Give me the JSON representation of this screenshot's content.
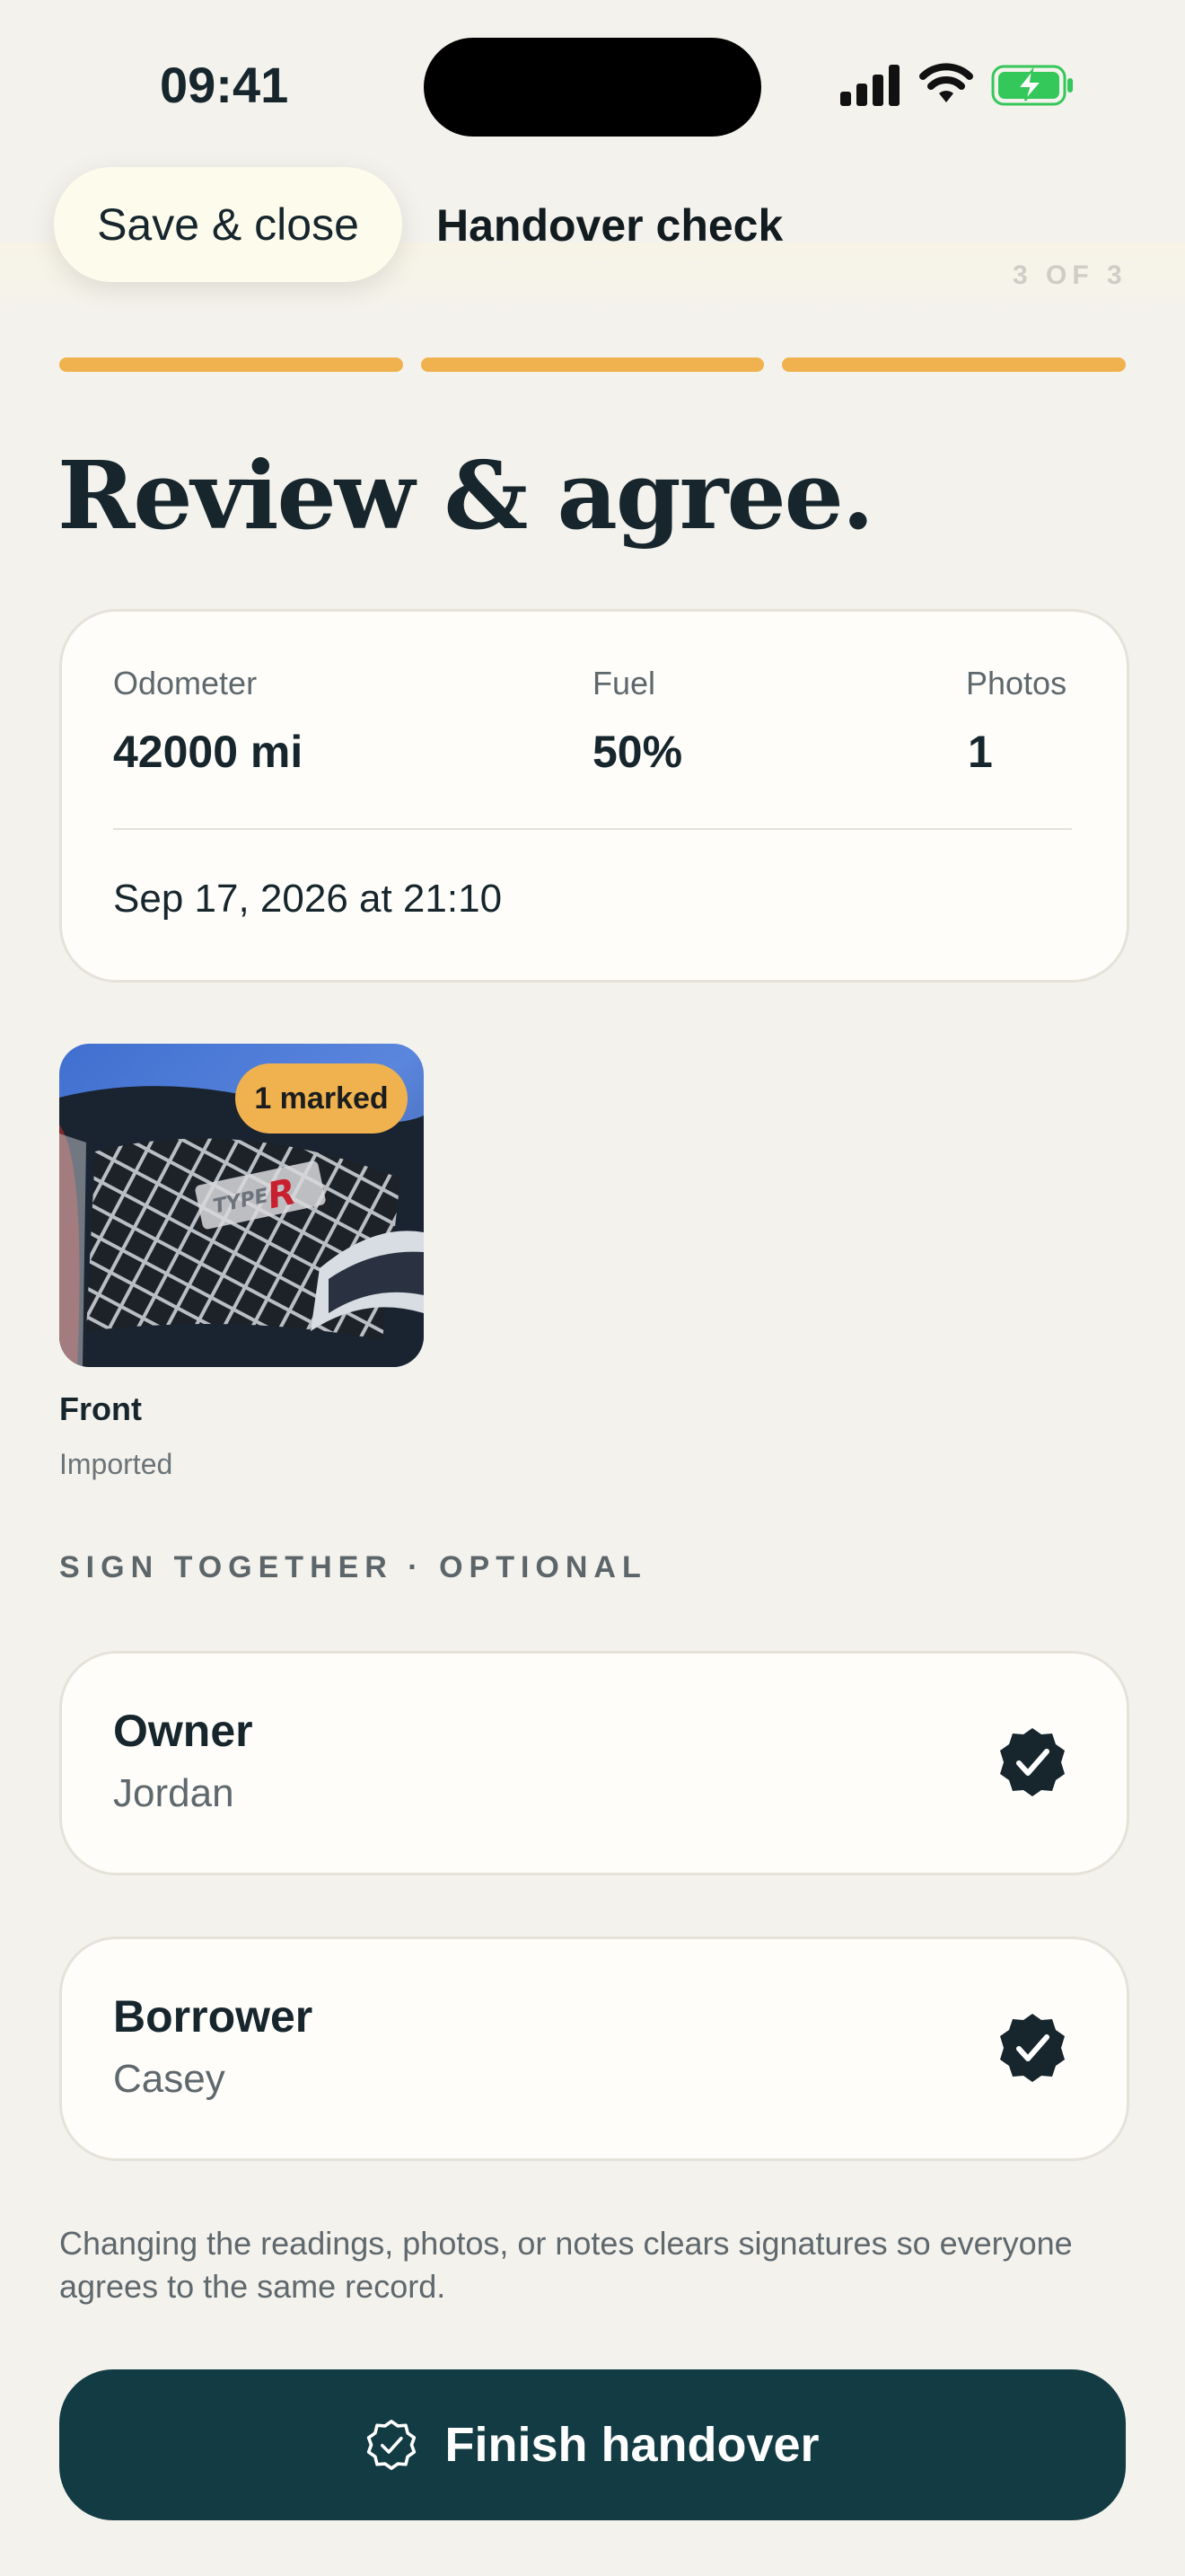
{
  "status_bar": {
    "time": "09:41",
    "icons": [
      "cellular-signal-icon",
      "wifi-icon",
      "battery-charging-icon"
    ]
  },
  "header": {
    "save_close_label": "Save & close",
    "title": "Handover check",
    "step_indicator": "3 OF 3",
    "progress": {
      "completed_steps": 3,
      "total_steps": 3
    }
  },
  "page_title": "Review & agree.",
  "summary": {
    "stats": [
      {
        "label": "Odometer",
        "value": "42000 mi"
      },
      {
        "label": "Fuel",
        "value": "50%"
      },
      {
        "label": "Photos",
        "value": "1"
      }
    ],
    "timestamp": "Sep 17, 2026 at 21:10"
  },
  "photos": [
    {
      "badge": "1 marked",
      "name": "Front",
      "source": "Imported"
    }
  ],
  "sign_section": {
    "label": "SIGN TOGETHER · OPTIONAL",
    "signers": [
      {
        "role": "Owner",
        "name": "Jordan",
        "signed": true
      },
      {
        "role": "Borrower",
        "name": "Casey",
        "signed": true
      }
    ]
  },
  "note": "Changing the readings, photos, or notes clears signatures so everyone agrees to the same record.",
  "finish_button": {
    "label": "Finish handover",
    "icon": "verified-badge-icon"
  },
  "colors": {
    "background": "#f4f2ec",
    "accent_progress": "#f0b24e",
    "primary_button": "#123b43",
    "text_primary": "#17262d",
    "text_secondary": "#5e686d",
    "battery_green": "#34c759"
  }
}
